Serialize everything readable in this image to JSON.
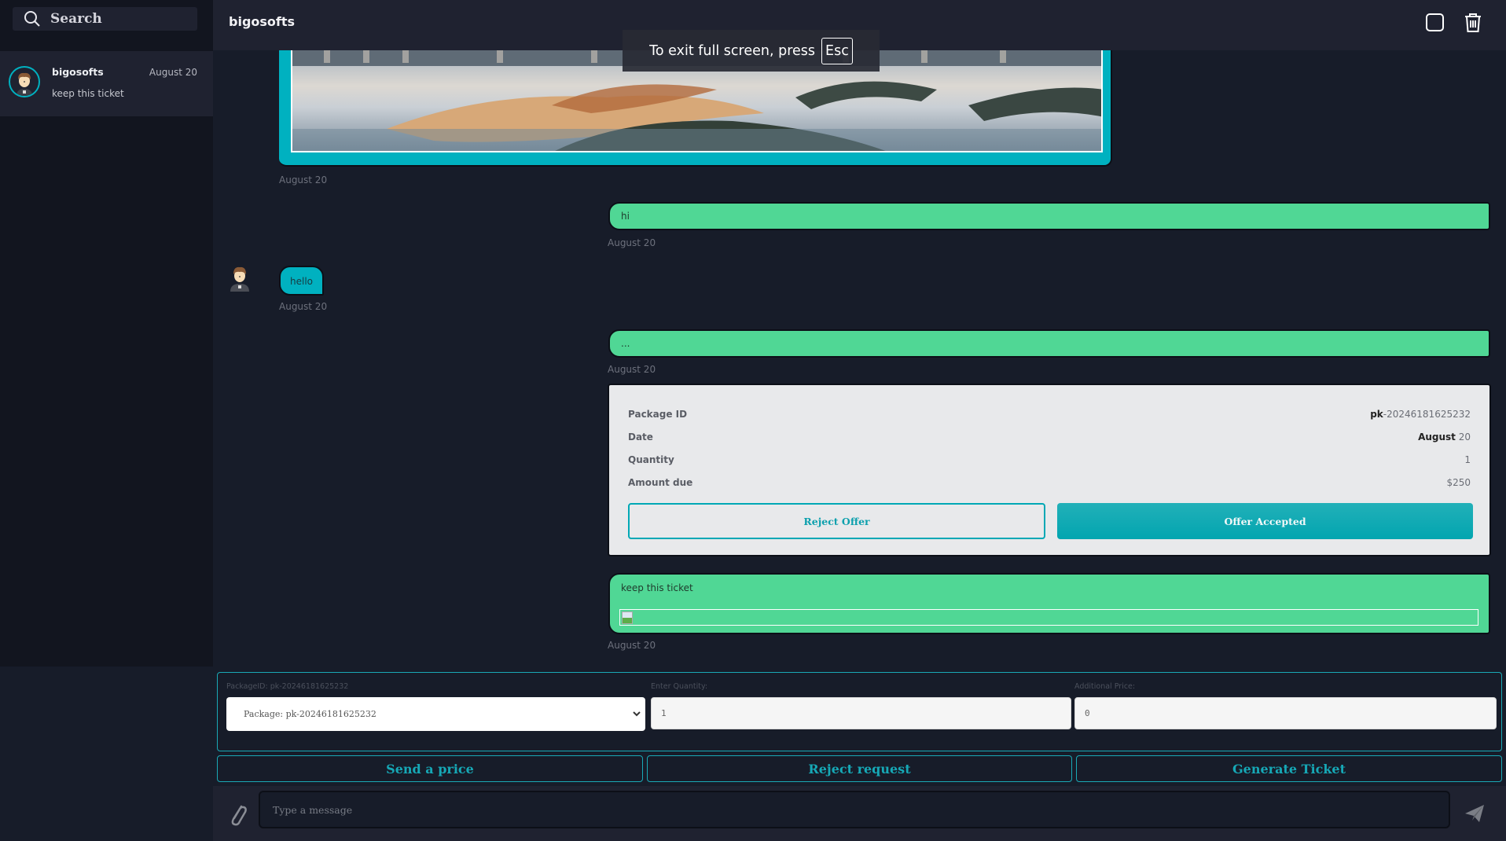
{
  "sidebar": {
    "search": {
      "placeholder": "Search",
      "icon": "search-icon"
    },
    "conversations": [
      {
        "name": "bigosofts",
        "date": "August 20",
        "preview": "keep this ticket",
        "active": true
      }
    ]
  },
  "header": {
    "title": "bigosofts",
    "icons": [
      "square-icon",
      "trash-icon"
    ]
  },
  "fullscreen_toast": {
    "text": "To exit full screen, press",
    "key": "Esc"
  },
  "messages": [
    {
      "type": "image",
      "direction": "incoming",
      "timestamp": "August 20"
    },
    {
      "type": "text",
      "direction": "outgoing",
      "text": "hi",
      "timestamp": "August 20"
    },
    {
      "type": "text",
      "direction": "incoming",
      "text": "hello",
      "timestamp": "August 20"
    },
    {
      "type": "text",
      "direction": "outgoing",
      "text": "...",
      "timestamp": "August 20"
    },
    {
      "type": "package_offer",
      "rows": [
        {
          "label": "Package ID",
          "value_bold": "pk",
          "value": "-20246181625232"
        },
        {
          "label": "Date",
          "value_bold": "August",
          "value": " 20"
        },
        {
          "label": "Quantity",
          "value_bold": "",
          "value": "1"
        },
        {
          "label": "Amount due",
          "value_bold": "",
          "value": "$250"
        }
      ],
      "reject_label": "Reject Offer",
      "accept_label": "Offer Accepted"
    },
    {
      "type": "text_attachment",
      "direction": "outgoing",
      "text": "keep this ticket",
      "timestamp": "August 20"
    }
  ],
  "ticket_form": {
    "package_label": "PackageID: pk-20246181625232",
    "package_selected": "Package: pk-20246181625232",
    "quantity_label": "Enter Quantity:",
    "quantity_value": "1",
    "price_label": "Additional Price:",
    "price_value": "0"
  },
  "actions": {
    "send_price": "Send a price",
    "reject_request": "Reject request",
    "generate_ticket": "Generate Ticket"
  },
  "composer": {
    "placeholder": "Type a message"
  },
  "colors": {
    "accent": "#00b1c0",
    "outgoing_bubble": "#50d795",
    "background": "#171c29",
    "panel": "#1f2230"
  }
}
